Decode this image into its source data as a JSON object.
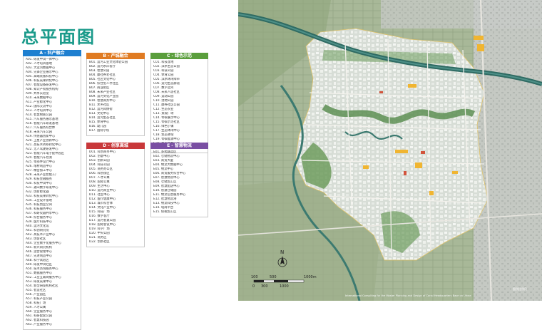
{
  "page_title": "总平面图",
  "legend": {
    "col_a": {
      "header": "A - 科产融合",
      "color": "#1e7fd0",
      "items": [
        "A01. 研发中试一体中心",
        "A02. 人才培训基地",
        "A03. 大运河数据中心",
        "A04. 先锋企业展示中心",
        "A05. 高端装备科技中心",
        "A06. 科技成果转化中心",
        "A07. 智能设备研发中心",
        "A08. 知识产权服务机构",
        "A09. 共享实验室",
        "A10. 未来数据中心",
        "A11. 产业孵化中心",
        "A12. 国际交流中心",
        "A13. 人才培训中心",
        "A14. 智慧物联公园",
        "A15. 汽车服务展示基地",
        "A16. 智能汽车研发基地",
        "A17. 汽车服务综合体",
        "A18. 未来汽车公园",
        "A19. 传感器创新中心",
        "A20. 卫星产业创新中心",
        "A21. 高技术转移转化中心",
        "A22. 无人驾驶研发中心",
        "A23. 智能汽车电子配件园区",
        "A24. 智能汽车检测",
        "A25. 零部件设计中心",
        "A26. 增材制造中心",
        "A27. 精密加工中心",
        "A28. 未来产业智能工厂",
        "A29. 科技金融服务",
        "A30. 科技中试中心",
        "A31. 通山数字研发中心",
        "A32. 创新孵化器",
        "A33. 科技成果转化中心",
        "A34. 工业设计基地",
        "A35. 科技创业空间",
        "A36. 科技服务中心",
        "A37. 科研仪器共享中心",
        "A38. 综合服务中心",
        "A39. 医疗科技中心",
        "A40. 运河文化馆",
        "A41. 科创研究院",
        "A42. 高技术产业中心",
        "A43. 创客社区",
        "A44. 企业数字化服务中心",
        "A45. 新兴研究机构",
        "A46. 运营管理中心",
        "A47. 先进制造中心",
        "A48. 科学试验区",
        "A49. 研发中试社区",
        "A50. 技术咨询服务中心",
        "A51. 数据服务中心",
        "A52. 工业互联网服务中心",
        "A53. 研发成果中心",
        "A54. 新型研发机构社区",
        "A55. 智造社区",
        "A56. 产业园区",
        "A57. 科技产业公园",
        "A58. 科技广场",
        "A59. 人才公寓",
        "A60. 企业服务中心",
        "A61. 科研配套公园",
        "A62. 智慧科技园",
        "A63. 产业服务中心"
      ]
    },
    "col_b": {
      "header": "B - 产城融合",
      "color": "#e07b22",
      "items": [
        "B01. 运河工业文化体验公园",
        "B02. 运河水岸客厅",
        "B03. 智慧公园",
        "B04. 康社养老社区",
        "B05. 社区文化中心",
        "B06. 综合型人才社区",
        "B07. 商业街区",
        "B08. 未来产业社区",
        "B09. 运河文化产业园",
        "B10. 智慧商务中心",
        "B11. 水乡社区",
        "B12. 运河风情街",
        "B13. 文化中心",
        "B14. 运河生态社区",
        "B15. 体育中心",
        "B16. 幼儿园",
        "B17. 国际学校"
      ]
    },
    "col_c": {
      "header": "C - 绿色示范",
      "color": "#5a9e3c",
      "items": [
        "C01. 科技湿地",
        "C02. 滨水生态公园",
        "C03. 科技公园",
        "C04. 体育公园",
        "C05. 滨水休闲绿带",
        "C06. 运河生态廊道",
        "C07. 数字运河",
        "C08. 未来人居社区",
        "C09. 运动公园",
        "C10. 湿地公园",
        "C11. 康养社区公园",
        "C12. 生态农业",
        "C13. 景观广场",
        "C14. 零碳展示中心",
        "C15. 零碳示范社区",
        "C16. 绿色小镇",
        "C17. 生态休闲中心",
        "C18. 生态驿站",
        "C19. 零碳能源中心",
        "C20. 都市智慧农业",
        "C21. 城市公园"
      ]
    },
    "col_d": {
      "header": "D - 创享高城",
      "color": "#c8383a",
      "items": [
        "D01. 科创商务中心",
        "D02. 创意中心",
        "D03. 创新公园",
        "D04. 科技公园",
        "D05. 商务办公区",
        "D06. 科创街区",
        "D07. 人才公寓",
        "D08. 国际公寓",
        "D09. 生活中心",
        "D10. 运河商业中心",
        "D11. 社区中心",
        "D12. 医疗健康中心",
        "D13. 城市综合体",
        "D14. 文化产业中心",
        "D15. 科技广场",
        "D16. 数字客厅",
        "D17. 运河智慧公园",
        "D18. 国际会议中心",
        "D19. 科学广场",
        "D20. 中央公园",
        "D21. 商务区",
        "D22. 创新社区"
      ]
    },
    "col_e": {
      "header": "E - 智慧物流",
      "color": "#7a4fa3",
      "items": [
        "E01. 多式联运区",
        "E02. 仓储物流中心",
        "E03. 商贸大厦",
        "E04. 物流大数据中心",
        "E05. 物流中心",
        "E06. 商贸服务综合中心",
        "E07. 智慧物流中心",
        "E08. 仓储加工区",
        "E09. 智慧配送中心",
        "E10. 智慧仓储园",
        "E11. 物流信息服务中心",
        "E12. 智慧物流港",
        "E13. 物流科技中心",
        "E14. 电商平台",
        "E15. 保税加工区"
      ]
    }
  },
  "map": {
    "scale_labels": [
      "100",
      "500",
      "1000m",
      "0",
      "300",
      "1000"
    ],
    "north_label": "N",
    "caption": "International Consulting for the Master Planning and Design of Canal Headquarters Base on Urban",
    "corner_note": "图例比例尺"
  }
}
